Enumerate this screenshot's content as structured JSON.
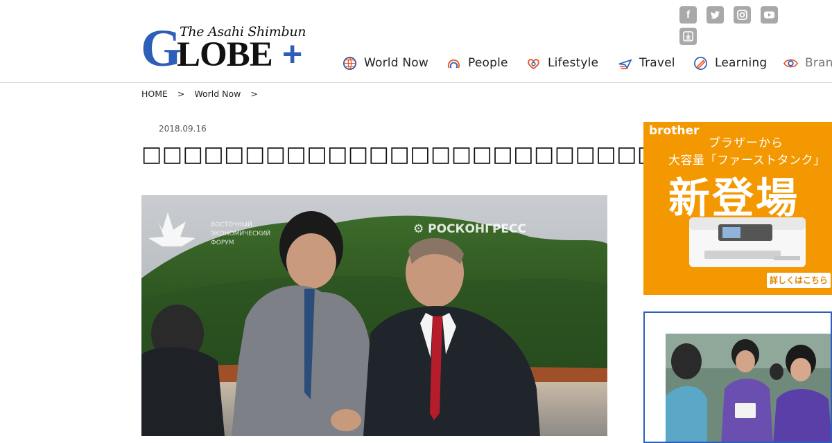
{
  "header": {
    "logo": {
      "top_text": "The Asahi Shimbun",
      "g_letter": "G",
      "lobe_text": "LOBE",
      "plus": "+"
    },
    "social": [
      {
        "name": "facebook-icon",
        "glyph": "f"
      },
      {
        "name": "twitter-icon",
        "glyph": ""
      },
      {
        "name": "instagram-icon",
        "glyph": ""
      },
      {
        "name": "youtube-icon",
        "glyph": ""
      },
      {
        "name": "download-icon",
        "glyph": ""
      }
    ],
    "nav": [
      {
        "label": "World Now",
        "icon": "globe-icon"
      },
      {
        "label": "People",
        "icon": "people-icon"
      },
      {
        "label": "Lifestyle",
        "icon": "heart-icon"
      },
      {
        "label": "Travel",
        "icon": "plane-icon"
      },
      {
        "label": "Learning",
        "icon": "pencil-icon"
      },
      {
        "label": "Bran",
        "icon": "eye-icon"
      }
    ]
  },
  "breadcrumb": {
    "home": "HOME",
    "sep1": ">",
    "section": "World Now",
    "sep2": ">"
  },
  "article": {
    "date": "2018.09.16",
    "title": "□□□□□□□□□□□□□□□□□□□□□□□□□"
  },
  "ads": {
    "ad1": {
      "brand": "brother",
      "line1": "ブラザーから",
      "line2": "大容量「ファーストタンク」",
      "headline": "新登場",
      "cta": "詳しくはこちら",
      "bg_color": "#f39800"
    }
  },
  "colors": {
    "brand_blue": "#2d5fb8",
    "icon_gray": "#a9a9a9"
  }
}
